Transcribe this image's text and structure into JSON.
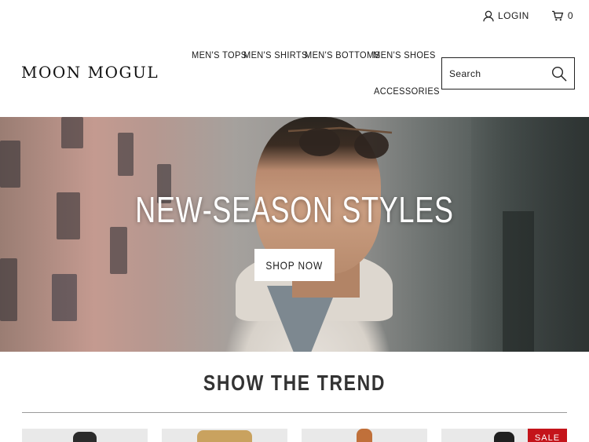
{
  "header": {
    "login_label": "LOGIN",
    "cart_count": "0",
    "logo": "MOON MOGUL"
  },
  "nav": {
    "items": [
      {
        "label": "MEN'S TOPS"
      },
      {
        "label": "MEN'S SHIRTS"
      },
      {
        "label": "MEN'S BOTTOMS"
      },
      {
        "label": "MEN'S SHOES"
      },
      {
        "label": "ACCESSORIES"
      }
    ]
  },
  "search": {
    "placeholder": "Search",
    "icon": "search-icon"
  },
  "hero": {
    "title": "NEW-SEASON STYLES",
    "button_label": "SHOP NOW"
  },
  "section": {
    "title": "SHOW THE TREND"
  },
  "products": [
    {
      "thumb_color": "#2b2b2b"
    },
    {
      "thumb_color": "#c9a25f"
    },
    {
      "thumb_color": "#c0703a"
    },
    {
      "thumb_color": "#1f1f1f",
      "badge": "SALE"
    }
  ],
  "colors": {
    "accent_sale": "#c4141a",
    "text": "#1a1a1a"
  }
}
